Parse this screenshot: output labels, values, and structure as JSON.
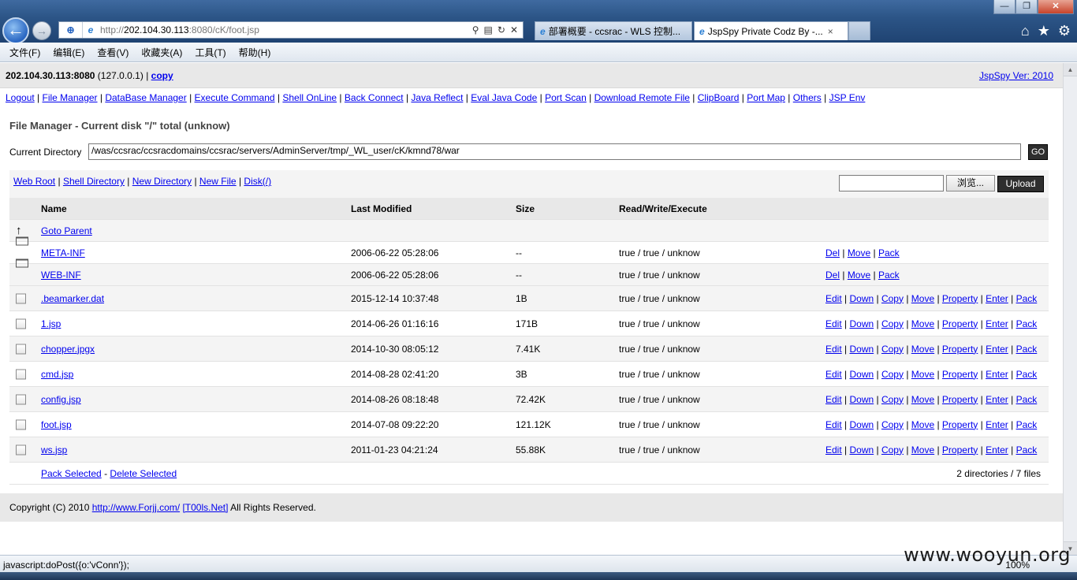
{
  "browser": {
    "url_prefix": "http://",
    "url_host": "202.104.30.113",
    "url_rest": ":8080/cK/foot.jsp",
    "tabs": [
      {
        "label": "部署概要 - ccsrac - WLS 控制..."
      },
      {
        "label": "JspSpy Private Codz By -..."
      }
    ],
    "tab_close": "×",
    "menu": [
      "文件(F)",
      "编辑(E)",
      "查看(V)",
      "收藏夹(A)",
      "工具(T)",
      "帮助(H)"
    ],
    "status_text": "javascript:doPost({o:'vConn'});",
    "zoom": "100%",
    "watermark": "www.wooyun.org"
  },
  "header": {
    "host": "202.104.30.113:8080",
    "ip": "(127.0.0.1)",
    "separator": "|",
    "copy_label": "copy",
    "version": "JspSpy Ver: 2010"
  },
  "nav": [
    "Logout",
    "File Manager",
    "DataBase Manager",
    "Execute Command",
    "Shell OnLine",
    "Back Connect",
    "Java Reflect",
    "Eval Java Code",
    "Port Scan",
    "Download Remote File",
    "ClipBoard",
    "Port Map",
    "Others",
    "JSP Env"
  ],
  "file_manager": {
    "title": "File Manager - Current disk \"/\" total (unknow)",
    "current_dir_label": "Current Directory",
    "current_dir": "/was/ccsrac/ccsracdomains/ccsrac/servers/AdminServer/tmp/_WL_user/cK/kmnd78/war",
    "go_label": "GO",
    "quick_links": [
      "Web Root",
      "Shell Directory",
      "New Directory",
      "New File",
      "Disk(/)"
    ],
    "browse_label": "浏览...",
    "upload_label": "Upload",
    "columns": {
      "name": "Name",
      "modified": "Last Modified",
      "size": "Size",
      "rwx": "Read/Write/Execute"
    },
    "parent_label": "Goto Parent",
    "dirs": [
      {
        "name": "META-INF",
        "modified": "2006-06-22 05:28:06",
        "size": "--",
        "rwx": "true / true / unknow"
      },
      {
        "name": "WEB-INF",
        "modified": "2006-06-22 05:28:06",
        "size": "--",
        "rwx": "true / true / unknow"
      }
    ],
    "dir_actions": [
      "Del",
      "Move",
      "Pack"
    ],
    "files": [
      {
        "name": ".beamarker.dat",
        "modified": "2015-12-14 10:37:48",
        "size": "1B",
        "rwx": "true / true / unknow"
      },
      {
        "name": "1.jsp",
        "modified": "2014-06-26 01:16:16",
        "size": "171B",
        "rwx": "true / true / unknow"
      },
      {
        "name": "chopper.jpgx",
        "modified": "2014-10-30 08:05:12",
        "size": "7.41K",
        "rwx": "true / true / unknow"
      },
      {
        "name": "cmd.jsp",
        "modified": "2014-08-28 02:41:20",
        "size": "3B",
        "rwx": "true / true / unknow"
      },
      {
        "name": "config.jsp",
        "modified": "2014-08-26 08:18:48",
        "size": "72.42K",
        "rwx": "true / true / unknow"
      },
      {
        "name": "foot.jsp",
        "modified": "2014-07-08 09:22:20",
        "size": "121.12K",
        "rwx": "true / true / unknow"
      },
      {
        "name": "ws.jsp",
        "modified": "2011-01-23 04:21:24",
        "size": "55.88K",
        "rwx": "true / true / unknow"
      }
    ],
    "file_actions": [
      "Edit",
      "Down",
      "Copy",
      "Move",
      "Property",
      "Enter",
      "Pack"
    ],
    "pack_selected": "Pack Selected",
    "dash": "-",
    "delete_selected": "Delete Selected",
    "count": "2 directories / 7 files"
  },
  "footer": {
    "prefix": "Copyright (C) 2010",
    "site": "http://www.Forjj.com/",
    "team": "[T00ls.Net]",
    "suffix": "All Rights Reserved."
  }
}
